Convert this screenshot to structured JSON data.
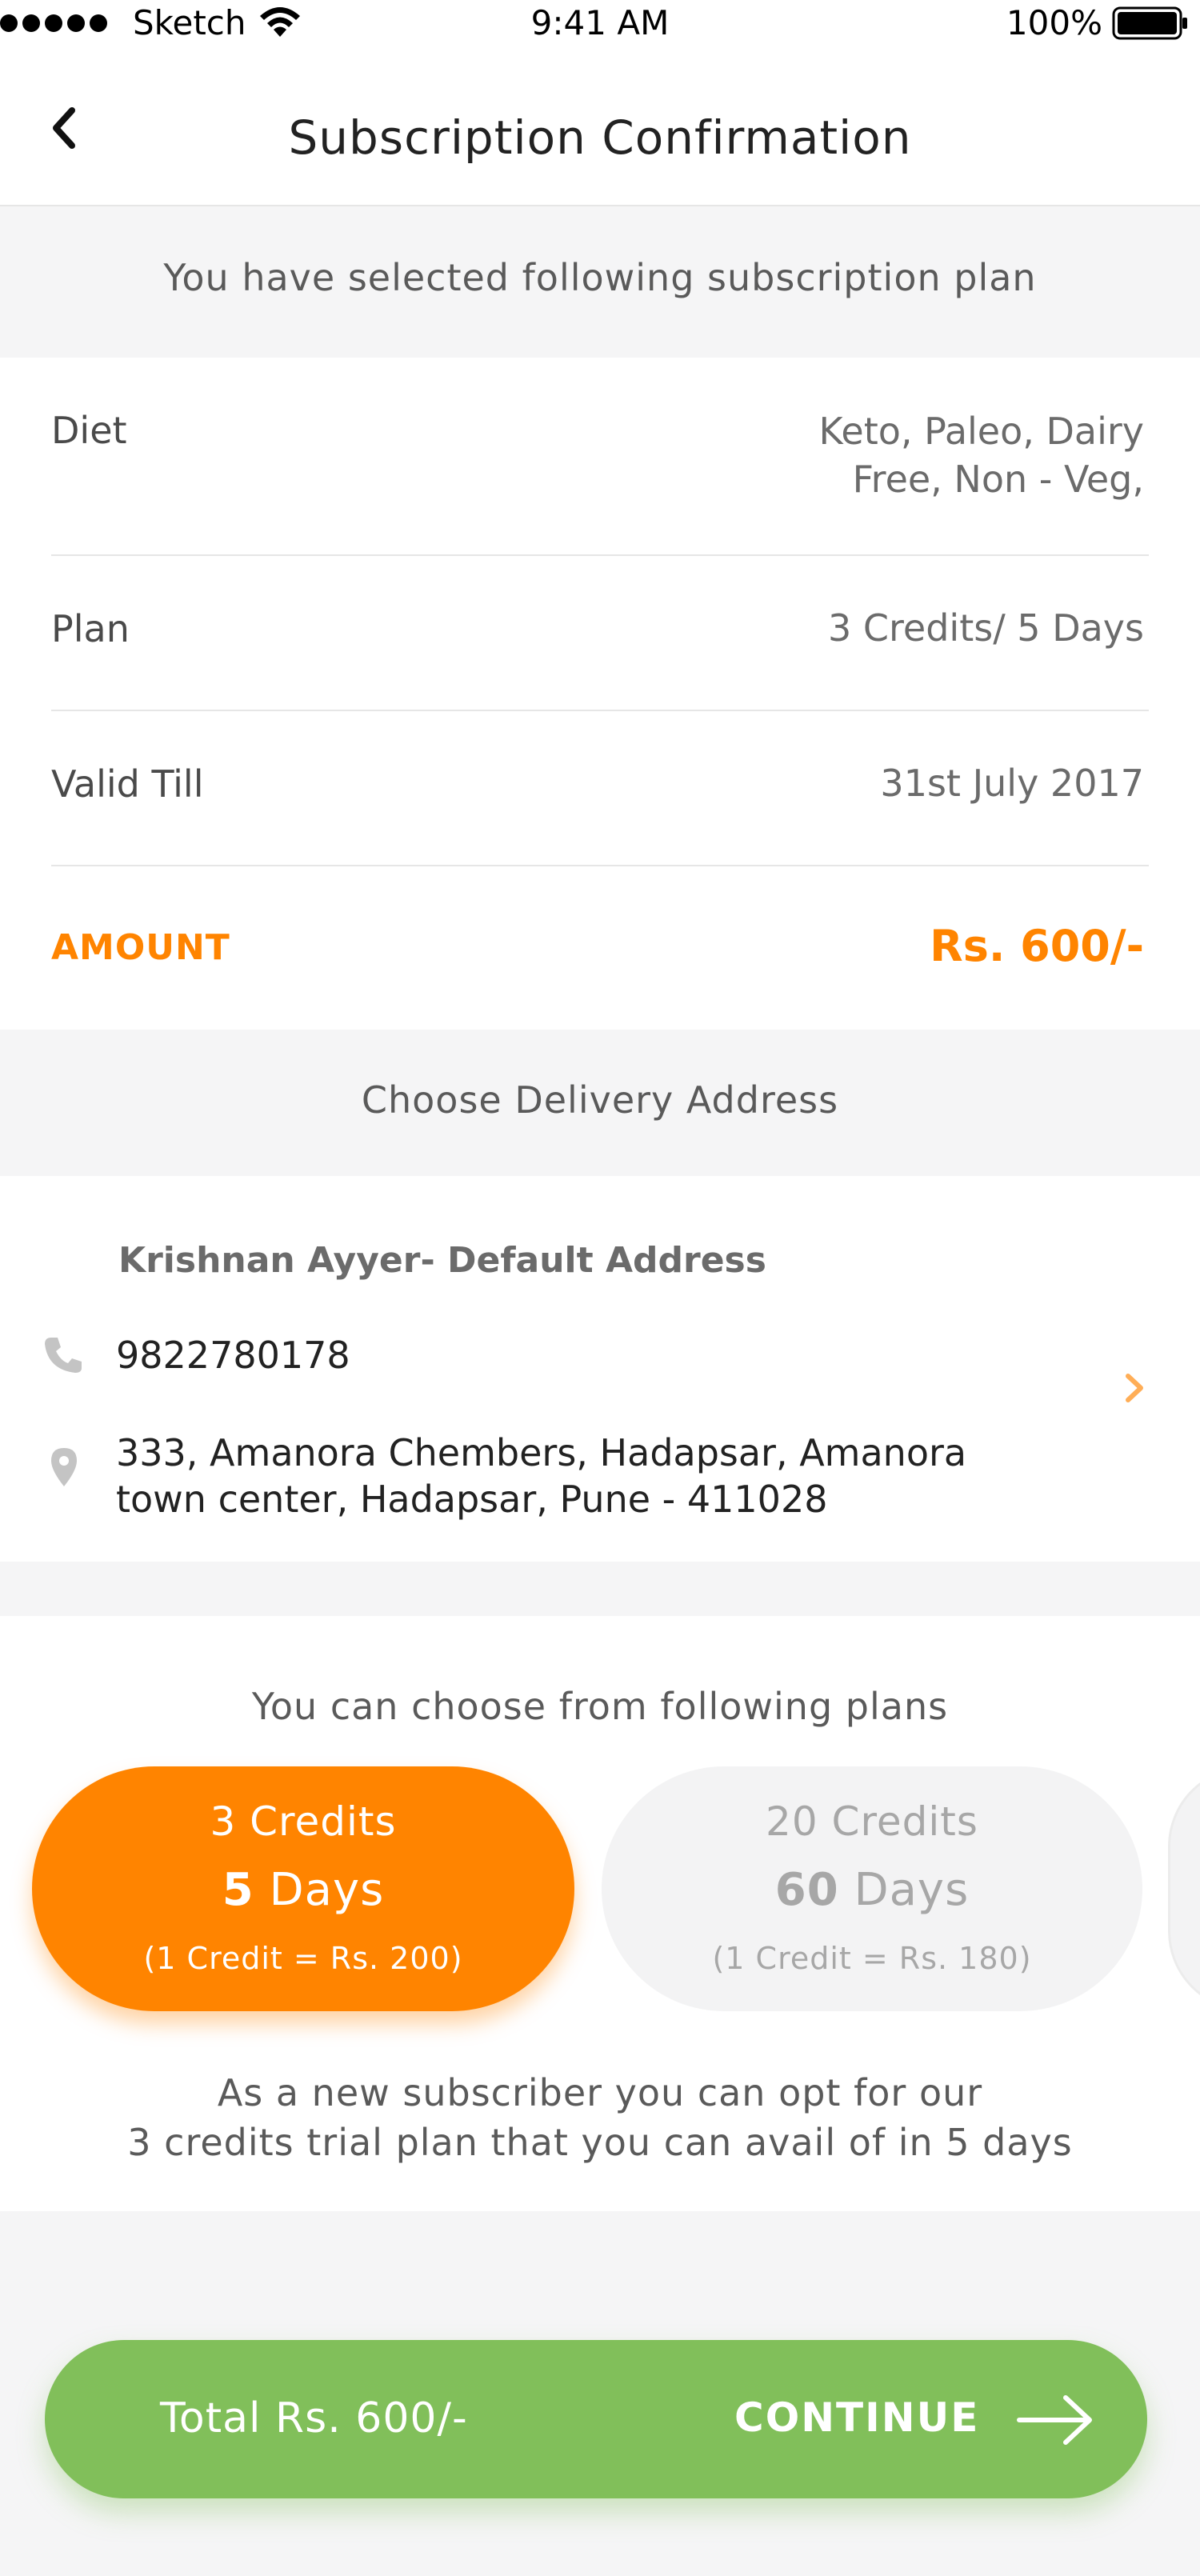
{
  "status_bar": {
    "carrier": "Sketch",
    "time": "9:41 AM",
    "battery": "100%"
  },
  "nav": {
    "title": "Subscription Confirmation"
  },
  "summary": {
    "intro": "You have selected following subscription plan",
    "rows": [
      {
        "label": "Diet",
        "value_line1": "Keto, Paleo, Dairy",
        "value_line2": "Free, Non - Veg,"
      },
      {
        "label": "Plan",
        "value": "3 Credits/ 5 Days"
      },
      {
        "label": "Valid Till",
        "value": "31st July 2017"
      }
    ],
    "amount_label": "AMOUNT",
    "amount_value": "Rs. 600/-"
  },
  "delivery": {
    "heading": "Choose Delivery Address",
    "name": "Krishnan Ayyer- Default Address",
    "phone": "9822780178",
    "address_line1": "333, Amanora Chembers, Hadapsar, Amanora",
    "address_line2": "town center, Hadapsar, Pune - 411028"
  },
  "plans": {
    "title": "You can choose from following plans",
    "options": [
      {
        "credits": "3 Credits",
        "days_num": "5",
        "days_word": " Days",
        "rate": "(1 Credit = Rs. 200)",
        "selected": true
      },
      {
        "credits": "20 Credits",
        "days_num": "60",
        "days_word": " Days",
        "rate": "(1 Credit = Rs. 180)",
        "selected": false
      }
    ],
    "note_line1": "As a new subscriber you can opt for our",
    "note_line2": "3 credits trial plan that you can avail of in 5 days"
  },
  "footer": {
    "total": "Total Rs. 600/-",
    "continue": "CONTINUE"
  },
  "colors": {
    "accent": "#ff8400",
    "success": "#81bf5a",
    "background": "#f5f5f6"
  }
}
